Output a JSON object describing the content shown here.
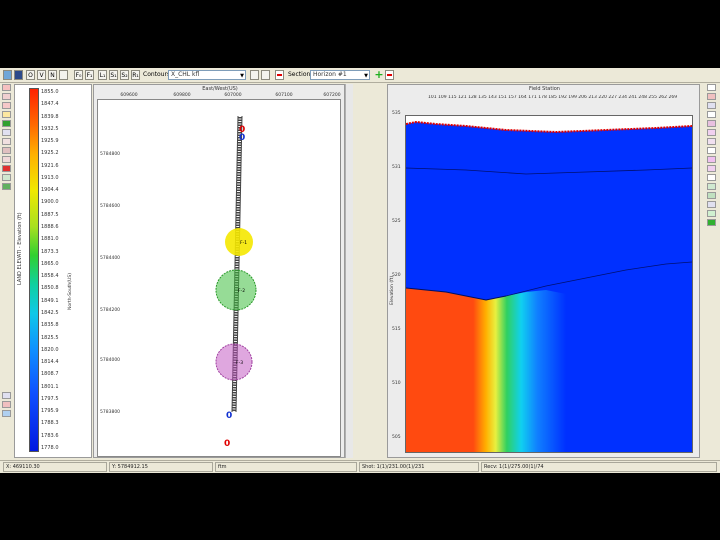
{
  "toolbar": {
    "buttons": [
      "O",
      "V",
      "N",
      "F₀",
      "F₁",
      "L₁",
      "S₁",
      "S₂",
      "R₁"
    ],
    "contour_label": "Contours",
    "contour_value": "X_CHL kfl",
    "section_label": "Section",
    "section_value": "Horizon #1",
    "add_icon": "plus-icon",
    "remove_icon": "minus-icon"
  },
  "colorbar": {
    "title": "LAND ELEVATI - Elevation (ft)",
    "ticks": [
      "1855.0",
      "1847.4",
      "1839.8",
      "1932.5",
      "1925.9",
      "1925.2",
      "1921.6",
      "1913.0",
      "1904.4",
      "1900.0",
      "1887.5",
      "1888.6",
      "1881.0",
      "1873.3",
      "1865.0",
      "1858.4",
      "1850.8",
      "1849.1",
      "1842.5",
      "1835.8",
      "1825.5",
      "1820.0",
      "1814.4",
      "1808.7",
      "1801.1",
      "1797.5",
      "1795.9",
      "1788.3",
      "1783.6",
      "1778.0"
    ]
  },
  "map": {
    "x_title": "East/West(US)",
    "x_ticks": [
      "609600",
      "609800",
      "607000",
      "607100",
      "607200"
    ],
    "y_title": "North-South(US)",
    "y_ticks": [
      "5784800",
      "5784600",
      "5784400",
      "5784200",
      "5784000",
      "5783800"
    ],
    "labels": [
      "F-1",
      "F-2",
      "F-3"
    ],
    "station_glyph": "0"
  },
  "section": {
    "title": "Field Station",
    "top_ticks": "101 109 115 121 128 135 143 151 157 164 171 178 185 192 199 206 213 220 227 234 241 248 255 262 269",
    "y_title": "Elevation (ft)",
    "y_ticks": [
      "535",
      "531",
      "525",
      "520",
      "515",
      "510",
      "505"
    ]
  },
  "status": {
    "x": "X: 469110.30",
    "y": "Y: 5784912.15",
    "units": "ftm",
    "shot": "Shot: 1(1)/231.00(1)/231",
    "recv": "Recv: 1(1)/275.00(1)/74"
  },
  "colors": {
    "accent_red": "#ff0000",
    "section_blue": "#0030ff",
    "section_red": "#ff4a10",
    "yellow_marker": "#f5e800",
    "green_marker": "#40c040",
    "purple_marker": "#c050c0"
  }
}
